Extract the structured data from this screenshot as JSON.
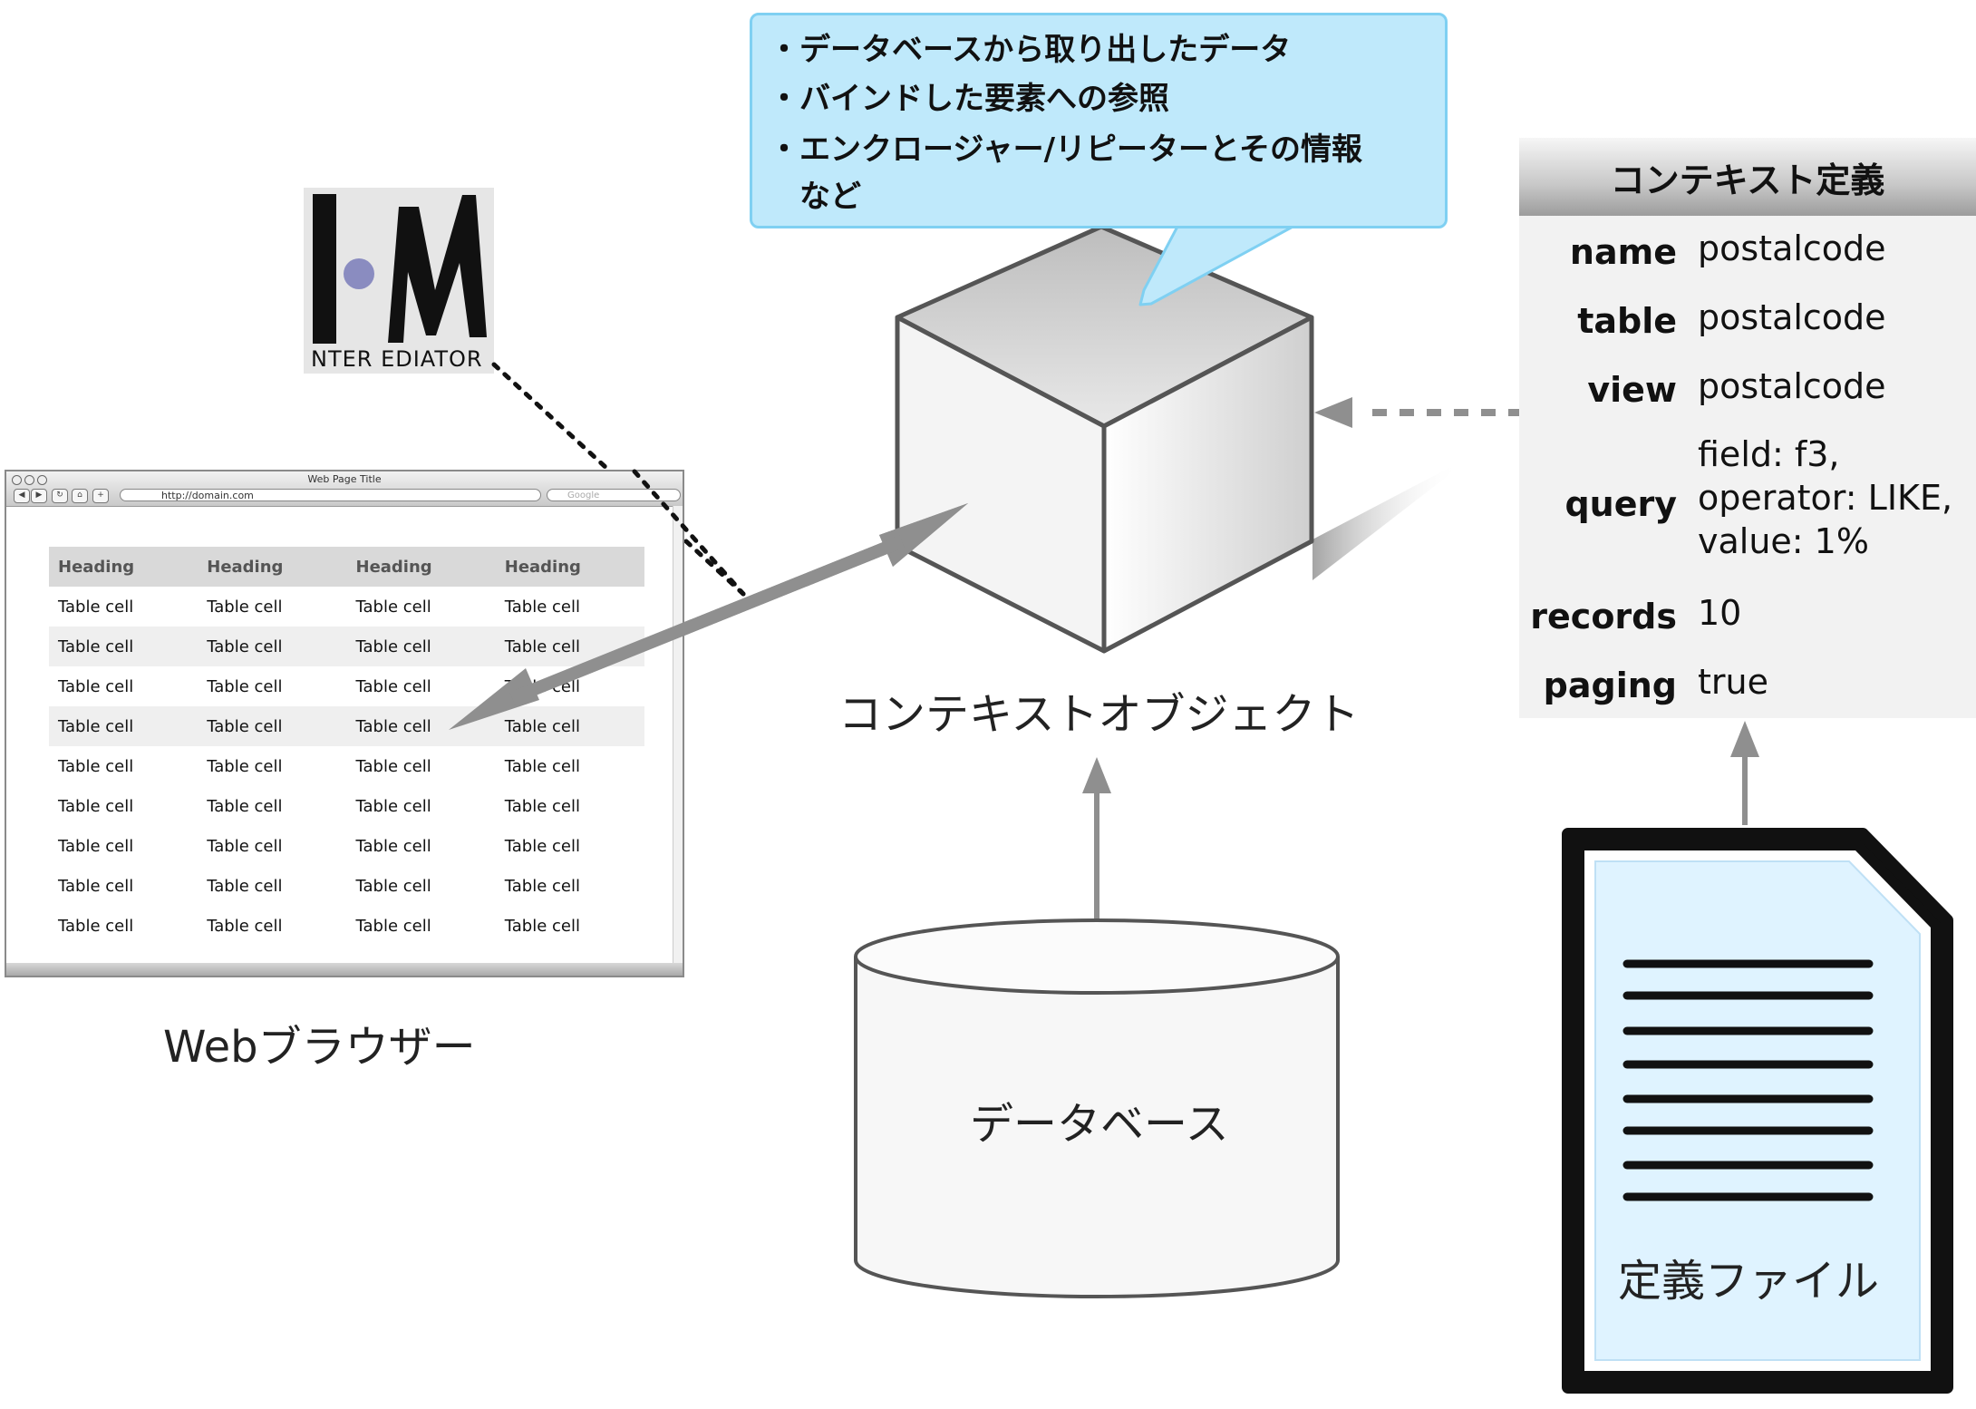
{
  "logo": {
    "text": "NTER EDIATOR"
  },
  "browser": {
    "title": "Web Page Title",
    "url": "http://domain.com",
    "search_placeholder": "Google",
    "headers": [
      "Heading",
      "Heading",
      "Heading",
      "Heading"
    ],
    "rows": [
      [
        "Table cell",
        "Table cell",
        "Table cell",
        "Table cell"
      ],
      [
        "Table cell",
        "Table cell",
        "Table cell",
        "Table cell"
      ],
      [
        "Table cell",
        "Table cell",
        "Table cell",
        "Table cell"
      ],
      [
        "Table cell",
        "Table cell",
        "Table cell",
        "Table cell"
      ],
      [
        "Table cell",
        "Table cell",
        "Table cell",
        "Table cell"
      ],
      [
        "Table cell",
        "Table cell",
        "Table cell",
        "Table cell"
      ],
      [
        "Table cell",
        "Table cell",
        "Table cell",
        "Table cell"
      ],
      [
        "Table cell",
        "Table cell",
        "Table cell",
        "Table cell"
      ],
      [
        "Table cell",
        "Table cell",
        "Table cell",
        "Table cell"
      ]
    ],
    "label": "Webブラウザー"
  },
  "callout": {
    "lines": [
      "・データベースから取り出したデータ",
      "・バインドした要素への参照",
      "・エンクロージャー/リピーターとその情報",
      "　など"
    ]
  },
  "context_object": {
    "label": "コンテキストオブジェクト"
  },
  "database": {
    "label": "データベース"
  },
  "definition": {
    "title": "コンテキスト定義",
    "entries": [
      {
        "key": "name",
        "value": "postalcode"
      },
      {
        "key": "table",
        "value": "postalcode"
      },
      {
        "key": "view",
        "value": "postalcode"
      },
      {
        "key": "query",
        "value_lines": [
          "field: f3,",
          "operator: LIKE,",
          "value: 1%"
        ]
      },
      {
        "key": "records",
        "value": "10"
      },
      {
        "key": "paging",
        "value": "true"
      }
    ]
  },
  "definition_file": {
    "label": "定義ファイル"
  },
  "colors": {
    "callout_fill": "#bfe9fb",
    "callout_border": "#7fd0f2",
    "arrow_gray": "#8f8f8f",
    "file_fill": "#dff3ff"
  }
}
